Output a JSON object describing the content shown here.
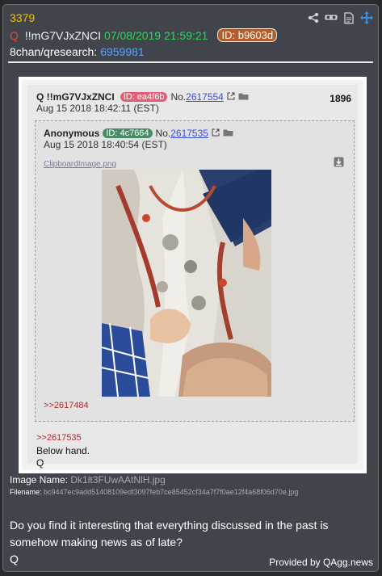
{
  "post": {
    "number": "3379",
    "q_letter": "Q",
    "tripcode": "!!mG7VJxZNCI",
    "datetime": "07/08/2019 21:59:21",
    "id_badge": "ID: b9603d",
    "board": "8chan/qresearch:",
    "thread_link": "6959981"
  },
  "screenshot": {
    "author": "Q !!mG7VJxZNCI",
    "id_badge": "ID: ea4f6b",
    "no_label": "No.",
    "no_value": "2617554",
    "count": "1896",
    "date": "Aug 15 2018 18:42:11 (EST)",
    "quoted": {
      "author": "Anonymous",
      "id_badge": "ID: 4c7664",
      "no_label": "No.",
      "no_value": "2617535",
      "date": "Aug 15 2018 18:40:54 (EST)",
      "file_link": "ClipboardImage.png",
      "reply_link": ">>2617484"
    },
    "reply_link": ">>2617535",
    "text": "Below hand.\nQ"
  },
  "image_name_label": "Image Name:",
  "image_name": "Dk1lt3FUwAAtNlH.jpg",
  "filename_label": "Filename:",
  "filename": "bc9447ec9add51408109edf3097feb7ce85452cf34a7f7f0ae12f4a68f06d70e.jpg",
  "message": "Do you find it interesting that everything discussed in the past is\nsomehow making news as of late?",
  "signature": "Q",
  "provided_by": "Provided by QAgg.news",
  "icons": [
    "share-icon",
    "goggles-icon",
    "document-icon",
    "move-icon",
    "external-link-icon",
    "folder-icon",
    "download-icon"
  ],
  "colors": {
    "accent_yellow": "#f2c200",
    "date_green": "#31d45c",
    "link_blue": "#5aa3ff",
    "q_red": "#e5473b"
  }
}
